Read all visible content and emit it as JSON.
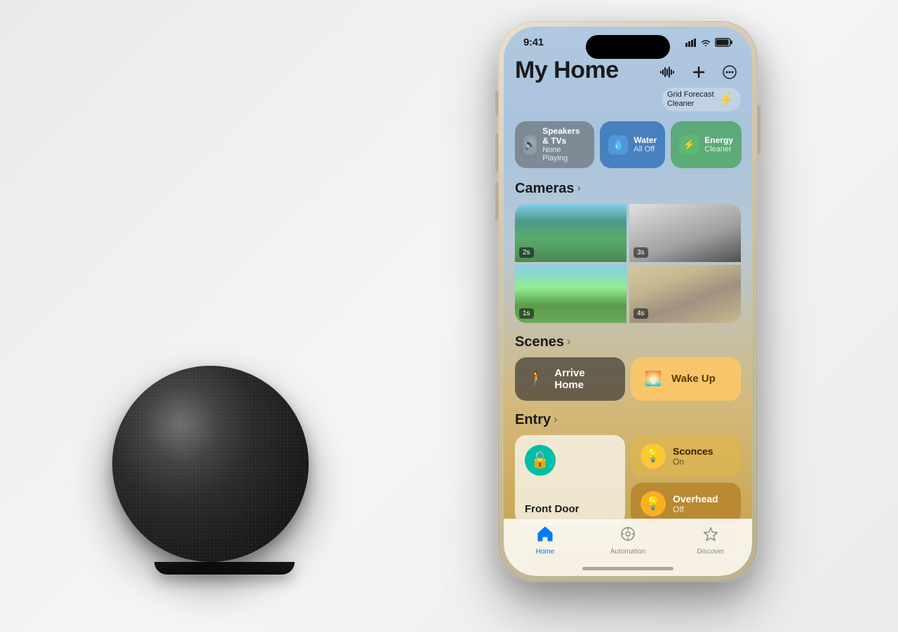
{
  "background": {
    "color": "#f0f0f0"
  },
  "status_bar": {
    "time": "9:41",
    "signal_bars": "▌▌▌▌",
    "wifi": "WiFi",
    "battery": "Battery"
  },
  "header": {
    "title": "My Home",
    "actions": {
      "waveform": "Waveform",
      "add": "+",
      "more": "···"
    },
    "grid_forecast": {
      "line1": "Grid Forecast",
      "line2": "Cleaner"
    }
  },
  "chips": {
    "speakers": {
      "icon": "🔊",
      "main": "Speakers & TVs",
      "sub": "None Playing"
    },
    "water": {
      "icon": "💧",
      "main": "Water",
      "sub": "All Off"
    },
    "energy": {
      "icon": "⚡",
      "main": "Energy",
      "sub": "Cleaner"
    }
  },
  "cameras": {
    "title": "Cameras",
    "items": [
      {
        "time": "2s"
      },
      {
        "time": "3s"
      },
      {
        "time": "1s"
      },
      {
        "time": "4s"
      }
    ]
  },
  "scenes": {
    "title": "Scenes",
    "items": [
      {
        "label": "Arrive Home",
        "icon": "🚶"
      },
      {
        "label": "Wake Up",
        "icon": "🌅"
      }
    ]
  },
  "entry": {
    "title": "Entry",
    "devices": [
      {
        "label": "Front Door",
        "icon": "🔓",
        "type": "door"
      },
      {
        "label": "Sconces",
        "status": "On",
        "icon": "💡",
        "type": "sconces"
      },
      {
        "label": "Overhead",
        "status": "Off",
        "icon": "💡",
        "type": "overhead"
      }
    ]
  },
  "tab_bar": {
    "items": [
      {
        "label": "Home",
        "icon": "⌂",
        "active": true
      },
      {
        "label": "Automation",
        "icon": "⏱",
        "active": false
      },
      {
        "label": "Discover",
        "icon": "★",
        "active": false
      }
    ]
  }
}
